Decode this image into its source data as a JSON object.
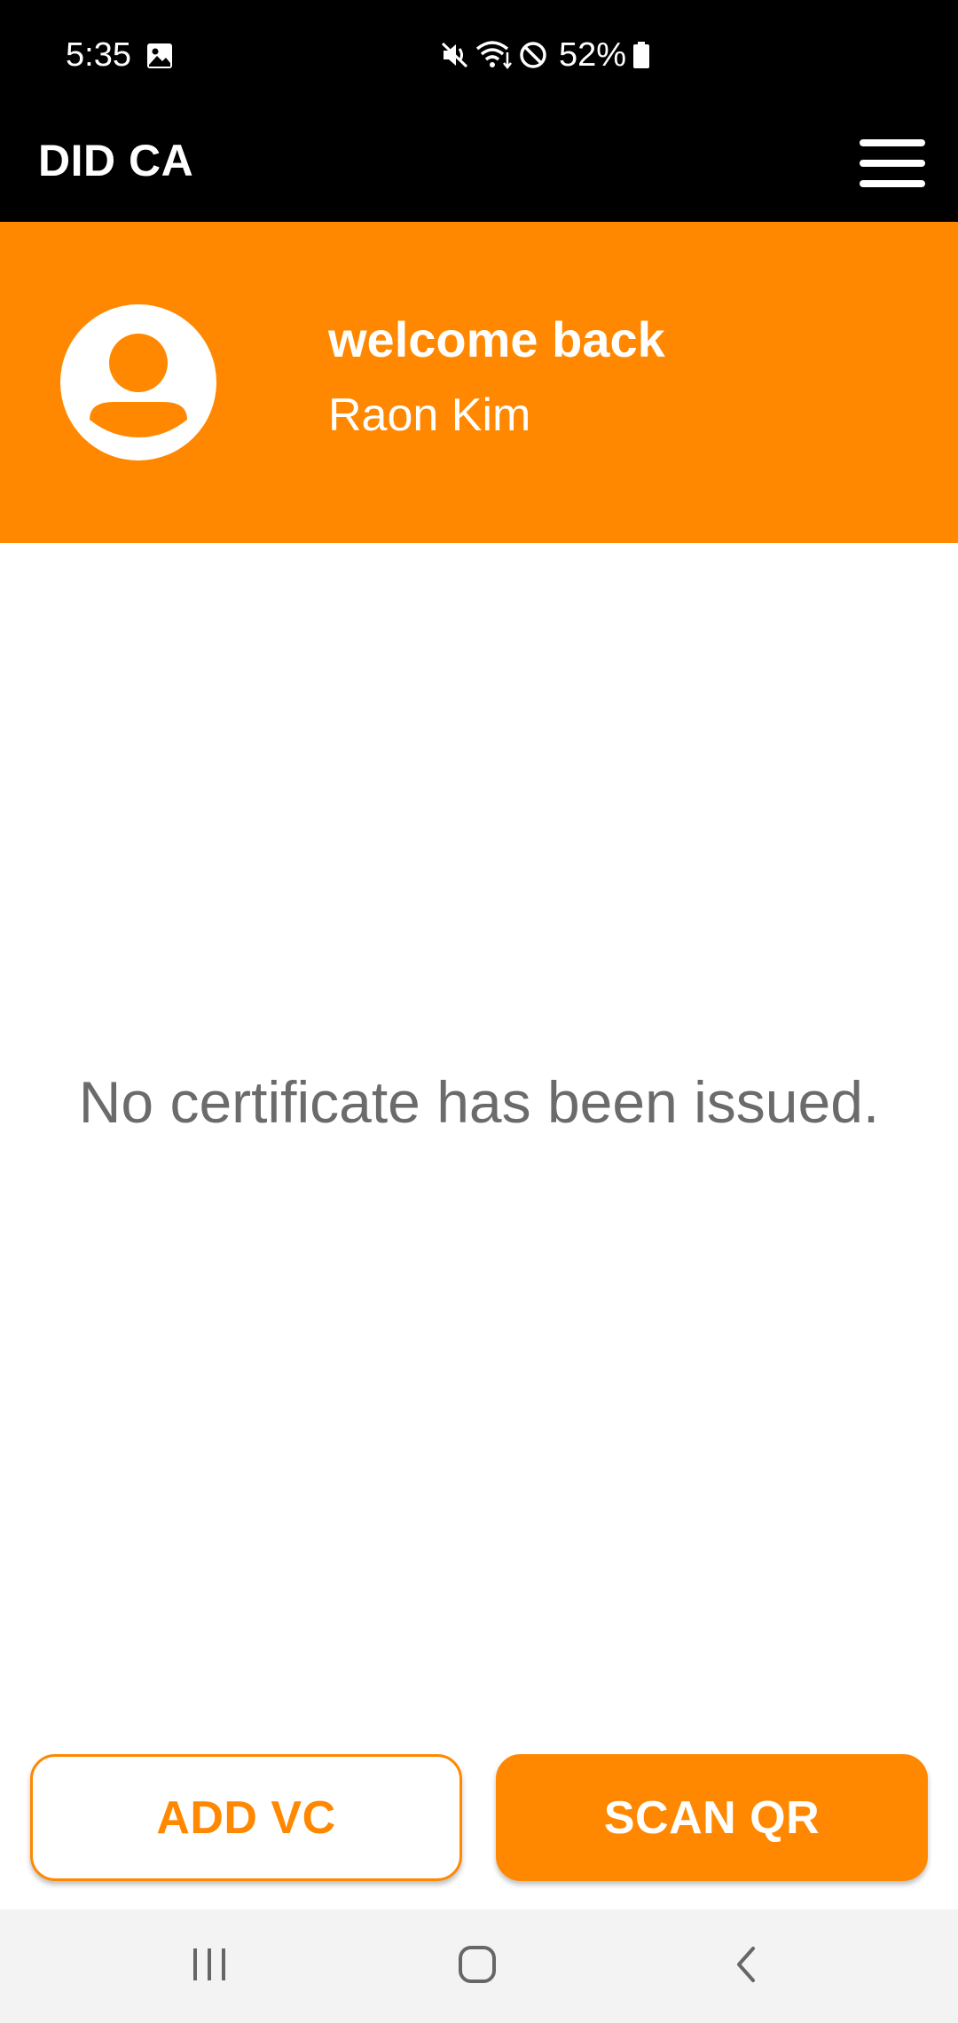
{
  "status_bar": {
    "time": "5:35",
    "battery": "52%",
    "icons": [
      "gallery-icon",
      "mute-icon",
      "wifi-icon",
      "do-not-disturb-icon",
      "battery-icon"
    ]
  },
  "app_bar": {
    "title": "DID CA",
    "menu_icon": "hamburger-menu-icon"
  },
  "header": {
    "greeting": "welcome back",
    "user_name": "Raon Kim",
    "avatar_icon": "user-avatar-icon"
  },
  "main": {
    "empty_message": "No certificate has been issued."
  },
  "actions": {
    "add_vc_label": "ADD VC",
    "scan_qr_label": "SCAN QR"
  },
  "nav_bar": {
    "icons": [
      "recents-icon",
      "home-icon",
      "back-icon"
    ]
  },
  "colors": {
    "accent": "#ff8800",
    "bars": "#000000",
    "empty_text": "#6b6b6b",
    "nav_background": "#f3f3f3"
  }
}
